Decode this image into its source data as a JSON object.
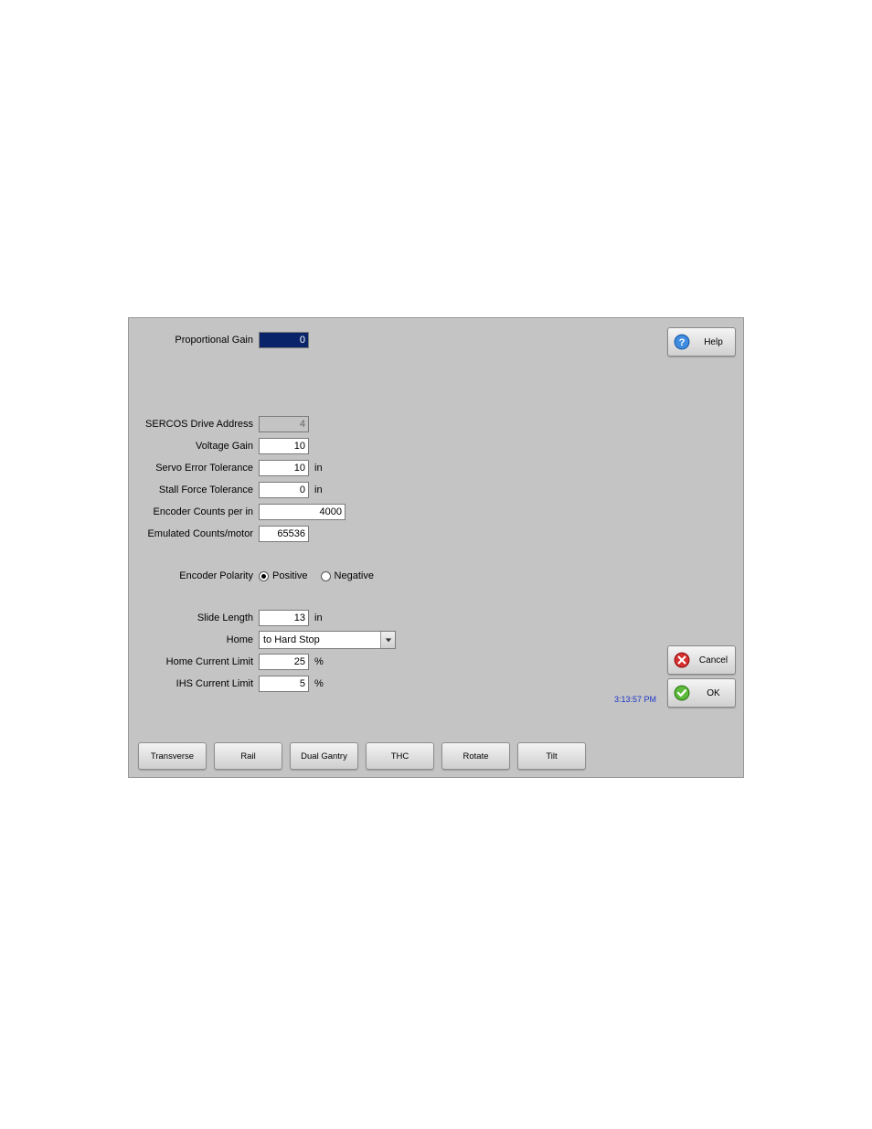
{
  "fields": {
    "proportional_gain": {
      "label": "Proportional Gain",
      "value": "0"
    },
    "sercos_addr": {
      "label": "SERCOS Drive Address",
      "value": "4"
    },
    "voltage_gain": {
      "label": "Voltage Gain",
      "value": "10"
    },
    "servo_error_tol": {
      "label": "Servo Error Tolerance",
      "value": "10",
      "unit": "in"
    },
    "stall_force_tol": {
      "label": "Stall Force Tolerance",
      "value": "0",
      "unit": "in"
    },
    "encoder_counts": {
      "label": "Encoder Counts per in",
      "value": "4000"
    },
    "emulated_counts": {
      "label": "Emulated Counts/motor",
      "value": "65536"
    },
    "encoder_polarity": {
      "label": "Encoder Polarity",
      "positive": "Positive",
      "negative": "Negative"
    },
    "slide_length": {
      "label": "Slide Length",
      "value": "13",
      "unit": "in"
    },
    "home": {
      "label": "Home",
      "value": "to Hard Stop"
    },
    "home_current_limit": {
      "label": "Home Current Limit",
      "value": "25",
      "unit": "%"
    },
    "ihs_current_limit": {
      "label": "IHS Current Limit",
      "value": "5",
      "unit": "%"
    }
  },
  "buttons": {
    "help": "Help",
    "cancel": "Cancel",
    "ok": "OK"
  },
  "timestamp": "3:13:57 PM",
  "tabs": [
    "Transverse",
    "Rail",
    "Dual Gantry",
    "THC",
    "Rotate",
    "Tilt"
  ]
}
